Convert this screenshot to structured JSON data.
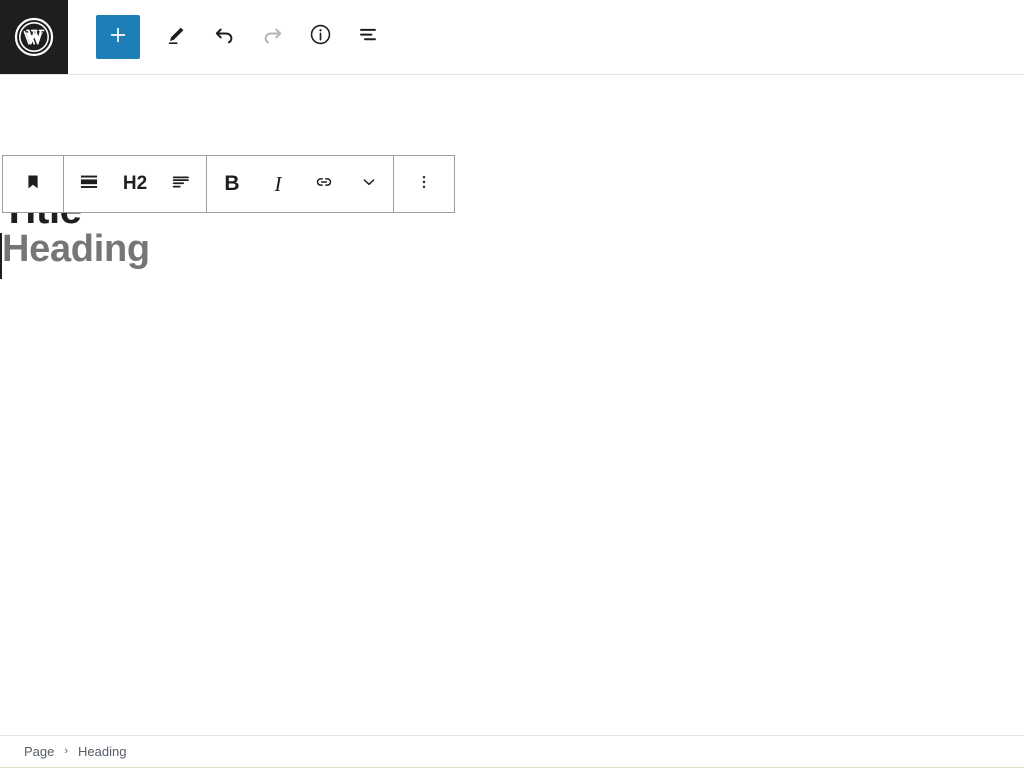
{
  "header": {
    "logo_icon": "wordpress-logo-icon",
    "tools": [
      {
        "name": "add-block-button",
        "label": "Add block",
        "icon": "plus-icon",
        "state": "active",
        "color": "#1e7eb8"
      },
      {
        "name": "edit-mode-button",
        "label": "Edit",
        "icon": "pencil-icon",
        "state": "enabled"
      },
      {
        "name": "undo-button",
        "label": "Undo",
        "icon": "undo-arrow-icon",
        "state": "enabled"
      },
      {
        "name": "redo-button",
        "label": "Redo",
        "icon": "redo-arrow-icon",
        "state": "disabled"
      },
      {
        "name": "details-button",
        "label": "Details",
        "icon": "info-circle-icon",
        "state": "enabled"
      },
      {
        "name": "list-view-button",
        "label": "List view",
        "icon": "list-view-icon",
        "state": "enabled"
      }
    ]
  },
  "canvas": {
    "post_title": "Title",
    "heading_block": {
      "placeholder": "Heading",
      "level": "H2",
      "caret_visible": true
    }
  },
  "block_toolbar": {
    "groups": [
      {
        "name": "block-type-group",
        "items": [
          {
            "name": "block-type-button",
            "label": "Heading",
            "icon": "bookmark-block-icon"
          }
        ]
      },
      {
        "name": "block-settings-group",
        "items": [
          {
            "name": "heading-level-button",
            "label": "Change heading level",
            "icon": "heading-level-icon"
          },
          {
            "name": "heading-level-label",
            "label": "H2",
            "icon": "text-label"
          },
          {
            "name": "align-text-button",
            "label": "Align text",
            "icon": "align-text-icon"
          }
        ]
      },
      {
        "name": "text-format-group",
        "items": [
          {
            "name": "bold-button",
            "label": "B",
            "icon": "bold-icon"
          },
          {
            "name": "italic-button",
            "label": "I",
            "icon": "italic-icon"
          },
          {
            "name": "link-button",
            "label": "Link",
            "icon": "link-icon"
          },
          {
            "name": "more-formats-button",
            "label": "More",
            "icon": "chevron-down-icon"
          }
        ]
      },
      {
        "name": "block-options-group",
        "items": [
          {
            "name": "block-options-button",
            "label": "Options",
            "icon": "three-dots-vertical-icon"
          }
        ]
      }
    ]
  },
  "footer": {
    "breadcrumb": {
      "separator": "›",
      "items": [
        {
          "name": "breadcrumb-item-page",
          "label": "Page"
        },
        {
          "name": "breadcrumb-item-heading",
          "label": "Heading"
        }
      ]
    }
  },
  "colors": {
    "accent_blue": "#1e7eb8",
    "logo_background": "#1e1e1e",
    "text_primary": "#1e1e1e",
    "text_placeholder": "#767676",
    "border_light": "#e2e4e7",
    "toolbar_border": "#9e9e9e",
    "disabled_icon": "#b5b5b5"
  }
}
